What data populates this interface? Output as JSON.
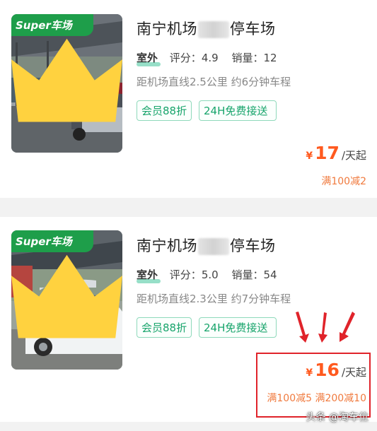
{
  "listings": [
    {
      "badge": "Super车场",
      "title_start": "南宁机场",
      "title_end": "停车场",
      "outdoor": "室外",
      "rating_label": "评分：",
      "rating": "4.9",
      "sales_label": "销量：",
      "sales": "12",
      "distance": "距机场直线2.5公里 约6分钟车程",
      "tags": [
        "会员88折",
        "24H免费接送"
      ],
      "currency": "¥",
      "price": "17",
      "price_unit": "/天起",
      "discount": "满100减2"
    },
    {
      "badge": "Super车场",
      "title_start": "南宁机场",
      "title_end": "停车场",
      "outdoor": "室外",
      "rating_label": "评分：",
      "rating": "5.0",
      "sales_label": "销量：",
      "sales": "54",
      "distance": "距机场直线2.3公里 约7分钟车程",
      "tags": [
        "会员88折",
        "24H免费接送"
      ],
      "currency": "¥",
      "price": "16",
      "price_unit": "/天起",
      "discount": "满100减5 满200减10"
    }
  ],
  "watermark": "头条 @淘车位",
  "colors": {
    "brand_green": "#1e9e4a",
    "tag_green": "#17a46b",
    "price_orange": "#ff5a1f",
    "annotation_red": "#e0232a"
  }
}
